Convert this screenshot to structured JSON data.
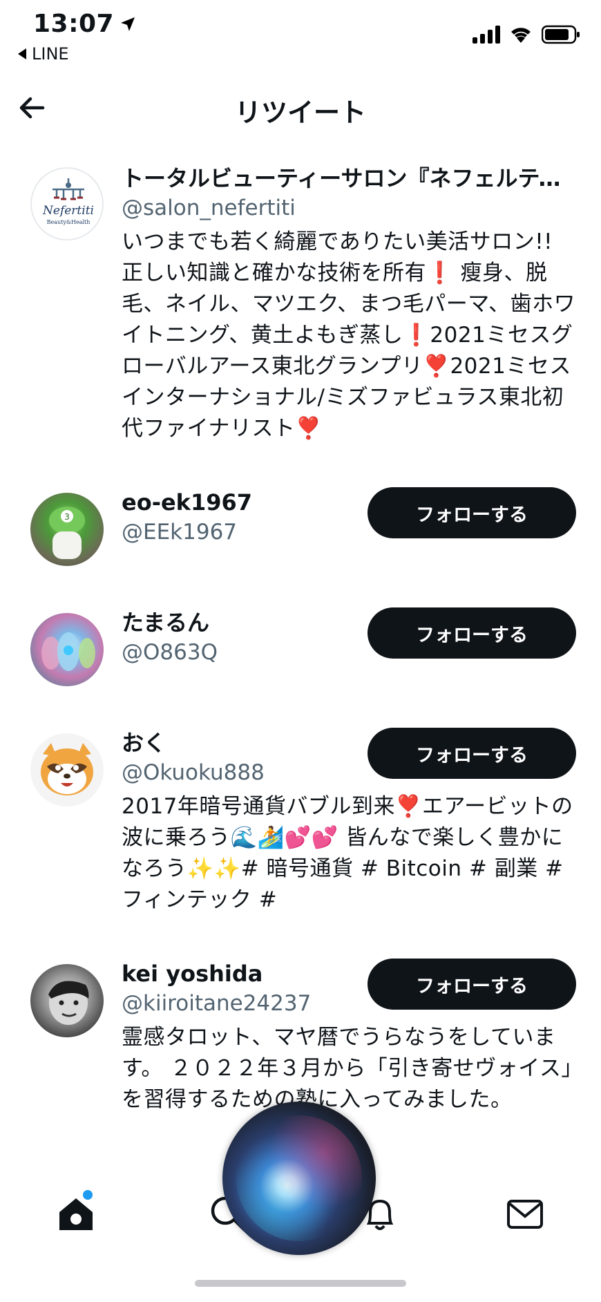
{
  "status_bar": {
    "time": "13:07",
    "back_app": "LINE"
  },
  "header": {
    "title": "リツイート"
  },
  "users": [
    {
      "name": "トータルビューティーサロン『ネフェルティティ』",
      "handle": "@salon_nefertiti",
      "bio": "いつまでも若く綺麗でありたい美活サロン!! 正しい知識と確かな技術を所有❗️ 瘦身、脱毛、ネイル、マツエク、まつ毛パーマ、歯ホワイトニング、黄土よもぎ蒸し❗️2021ミセスグローバルアース東北グランプリ❣️2021ミセスインターナショナル/ミズファビュラス東北初代ファイナリスト❣️",
      "avatar_text": "Nefertiti",
      "avatar_subtext": "Beauty&Health",
      "follow_label": ""
    },
    {
      "name": "eo-ek1967",
      "handle": "@EEk1967",
      "bio": "",
      "follow_label": "フォローする"
    },
    {
      "name": "たまるん",
      "handle": "@O863Q",
      "bio": "",
      "follow_label": "フォローする"
    },
    {
      "name": "おく",
      "handle": "@Okuoku888",
      "bio": "2017年暗号通貨バブル到来❣️エアービットの波に乗ろう🌊🏄💕💕 皆んなで楽しく豊かになろう✨✨# 暗号通貨 # Bitcoin # 副業 # フィンテック #",
      "follow_label": "フォローする"
    },
    {
      "name": "kei yoshida",
      "handle": "@kiiroitane24237",
      "bio": "霊感タロット、マヤ暦でうらなうをしています。 ２０２２年３月から「引き寄せヴォイス」を習得するための塾に入ってみました。",
      "follow_label": "フォローする"
    }
  ],
  "icons": {
    "home": "home-icon",
    "search": "search-icon",
    "notifications": "bell-icon",
    "messages": "mail-icon",
    "siri": "siri-orb"
  },
  "colors": {
    "text": "#0f1419",
    "secondary": "#536471",
    "accent": "#1d9bf0",
    "button": "#0f1419"
  }
}
